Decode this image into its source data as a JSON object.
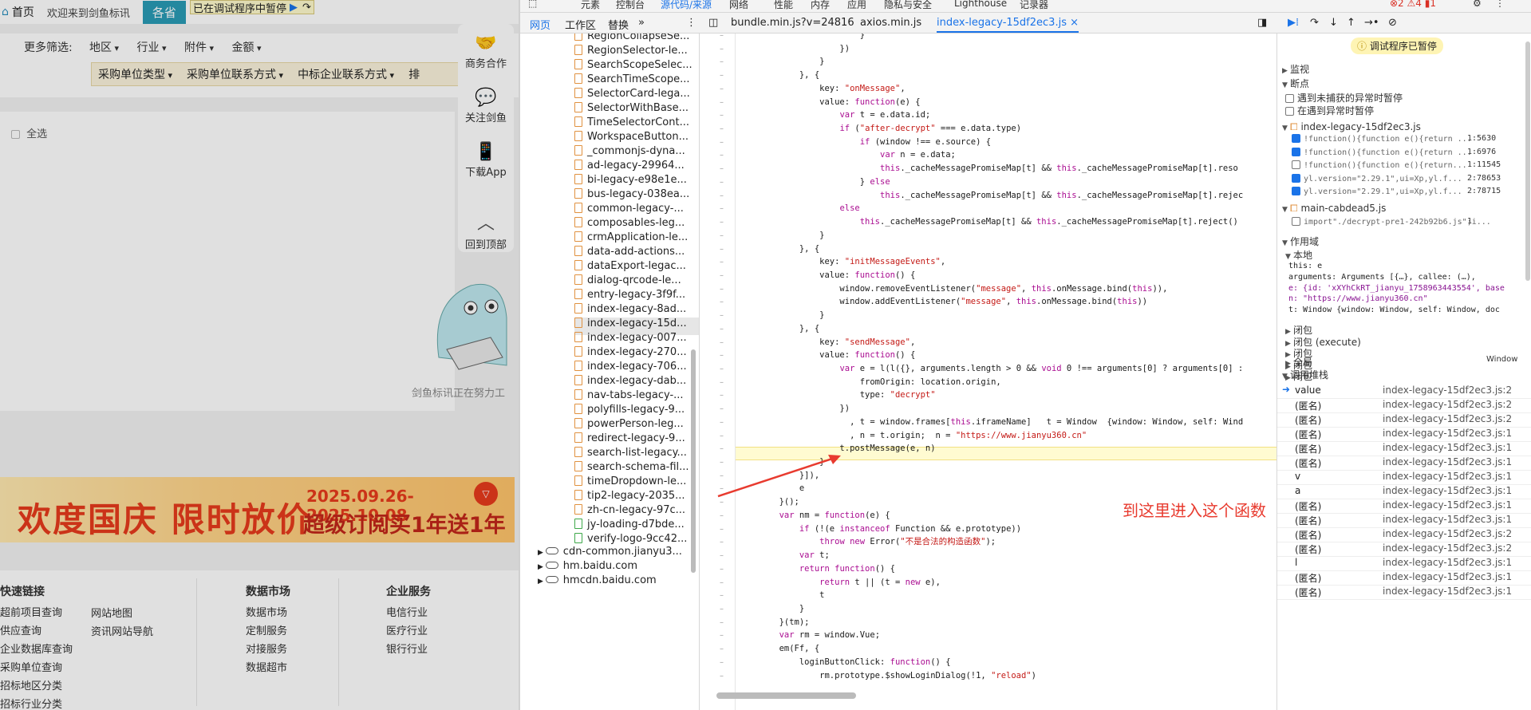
{
  "page": {
    "home": "首页",
    "welcome": "欢迎来到剑鱼标讯",
    "top_button": "各省",
    "paused_banner": "已在调试程序中暂停",
    "more_filters": "更多筛选:",
    "filters_row1": [
      "地区",
      "行业",
      "附件",
      "金额"
    ],
    "filters_row2": [
      "采购单位类型",
      "采购单位联系方式",
      "中标企业联系方式",
      "排"
    ],
    "select_all": "全选",
    "side_float": [
      "商务合作",
      "关注剑鱼",
      "下载App",
      "回到顶部"
    ],
    "mascot_caption": "剑鱼标讯正在努力工",
    "banner": {
      "main": "欢度国庆  限时放价",
      "date": "2025.09.26-2025.10.08",
      "sub": "超级订阅买1年送1年"
    },
    "footer": {
      "col1_title": "快速链接",
      "col1": [
        "超前项目查询",
        "供应查询",
        "企业数据库查询",
        "采购单位查询",
        "招标地区分类",
        "招标行业分类"
      ],
      "col1b": [
        "网站地图",
        "资讯网站导航"
      ],
      "col2_title": "数据市场",
      "col2": [
        "数据市场",
        "定制服务",
        "对接服务",
        "数据超市"
      ],
      "col3_title": "企业服务",
      "col3": [
        "电信行业",
        "医疗行业",
        "银行行业"
      ]
    }
  },
  "devtools": {
    "top_tabs": [
      "元素",
      "控制台",
      "源代码/来源",
      "网络",
      "性能",
      "内存",
      "应用",
      "隐私与安全",
      "Lighthouse",
      "记录器"
    ],
    "left_tabs": [
      "网页",
      "工作区",
      "替换"
    ],
    "file_tabs": [
      "bundle.min.js?v=24816",
      "axios.min.js",
      "index-legacy-15df2ec3.js"
    ],
    "files": [
      "RegionCollapseSe...",
      "RegionSelector-le...",
      "SearchScopeSelec...",
      "SearchTimeScope...",
      "SelectorCard-lega...",
      "SelectorWithBase...",
      "TimeSelectorCont...",
      "WorkspaceButton...",
      "_commonjs-dyna...",
      "ad-legacy-29964...",
      "bi-legacy-e98e1e...",
      "bus-legacy-038ea...",
      "common-legacy-...",
      "composables-leg...",
      "crmApplication-le...",
      "data-add-actions...",
      "dataExport-legac...",
      "dialog-qrcode-le...",
      "entry-legacy-3f9f...",
      "index-legacy-8ad...",
      "index-legacy-15d...",
      "index-legacy-007...",
      "index-legacy-270...",
      "index-legacy-706...",
      "index-legacy-dab...",
      "nav-tabs-legacy-...",
      "polyfills-legacy-9...",
      "powerPerson-leg...",
      "redirect-legacy-9...",
      "search-list-legacy...",
      "search-schema-fil...",
      "timeDropdown-le...",
      "tip2-legacy-2035...",
      "zh-cn-legacy-97c...",
      "jy-loading-d7bde...",
      "verify-logo-9cc42..."
    ],
    "domains": [
      "cdn-common.jianyu3...",
      "hm.baidu.com",
      "hmcdn.baidu.com"
    ],
    "code_lines": [
      "                        }",
      "                    })",
      "                }",
      "            }, {",
      "                key: \"onMessage\",",
      "                value: function(e) {",
      "                    var t = e.data.id;",
      "                    if (\"after-decrypt\" === e.data.type)",
      "                        if (window !== e.source) {",
      "                            var n = e.data;",
      "                            this._cacheMessagePromiseMap[t] && this._cacheMessagePromiseMap[t].reso",
      "                        } else",
      "                            this._cacheMessagePromiseMap[t] && this._cacheMessagePromiseMap[t].rejec",
      "                    else",
      "                        this._cacheMessagePromiseMap[t] && this._cacheMessagePromiseMap[t].reject()",
      "                }",
      "            }, {",
      "                key: \"initMessageEvents\",",
      "                value: function() {",
      "                    window.removeEventListener(\"message\", this.onMessage.bind(this)),",
      "                    window.addEventListener(\"message\", this.onMessage.bind(this))",
      "                }",
      "            }, {",
      "                key: \"sendMessage\",",
      "                value: function() {",
      "                    var e = l(l({}, arguments.length > 0 && void 0 !== arguments[0] ? arguments[0] :",
      "                        fromOrigin: location.origin,",
      "                        type: \"decrypt\"",
      "                    })",
      "                      , t = window.frames[this.iframeName]   t = Window  {window: Window, self: Wind",
      "                      , n = t.origin;  n = \"https://www.jianyu360.cn\"",
      "                    t.postMessage(e, n)",
      "                }",
      "            }]),",
      "            e",
      "        }();",
      "        var nm = function(e) {",
      "            if (!(e instanceof Function && e.prototype))",
      "                throw new Error(\"不是合法的构造函数\");",
      "            var t;",
      "            return function() {",
      "                return t || (t = new e),",
      "                t",
      "            }",
      "        }(tm);",
      "        var rm = window.Vue;",
      "        em(Ff, {",
      "            loginButtonClick: function() {",
      "                rm.prototype.$showLoginDialog(!1, \"reload\")"
    ],
    "annotation": "到这里进入这个函数（前提把所有断点取消掉）",
    "paused_label": "调试程序已暂停",
    "watch": "监视",
    "breakpoints_title": "断点",
    "bp_options": [
      "遇到未捕获的异常时暂停",
      "在遇到异常时暂停"
    ],
    "bp_file1": "index-legacy-15df2ec3.js",
    "bp_items": [
      {
        "code": "!function(){function e(){return ...",
        "loc": "1:5630",
        "checked": true
      },
      {
        "code": "!function(){function e(){return ...",
        "loc": "1:6976",
        "checked": true
      },
      {
        "code": "!function(){function e(){return...",
        "loc": "1:11545",
        "checked": false
      },
      {
        "code": "yl.version=\"2.29.1\",ui=Xp,yl.f...",
        "loc": "2:78653",
        "checked": true
      },
      {
        "code": "yl.version=\"2.29.1\",ui=Xp,yl.f...",
        "loc": "2:78715",
        "checked": true
      }
    ],
    "bp_file2": "main-cabdead5.js",
    "bp_item2": {
      "code": "import\"./decrypt-pre1-242b92b6.js\";i...",
      "loc": "1"
    },
    "scope_title": "作用域",
    "scope_local": "本地",
    "scope_rows": [
      "this: e",
      "arguments: Arguments [{…}, callee: (…), ",
      "e: {id: 'xXYhCkRT_jianyu_1758963443554', base",
      "n: \"https://www.jianyu360.cn\"",
      "t: Window {window: Window, self: Window, doc"
    ],
    "closures": [
      "闭包",
      "闭包 (execute)",
      "闭包",
      "闭包",
      "闭包"
    ],
    "global": "全局",
    "global_val": "Window",
    "callstack_title": "调用堆栈",
    "callstack": [
      {
        "name": "value",
        "file": "index-legacy-15df2ec3.js:2"
      },
      {
        "name": "(匿名)",
        "file": "index-legacy-15df2ec3.js:2"
      },
      {
        "name": "(匿名)",
        "file": "index-legacy-15df2ec3.js:2"
      },
      {
        "name": "(匿名)",
        "file": "index-legacy-15df2ec3.js:1"
      },
      {
        "name": "(匿名)",
        "file": "index-legacy-15df2ec3.js:1"
      },
      {
        "name": "(匿名)",
        "file": "index-legacy-15df2ec3.js:1"
      },
      {
        "name": "v",
        "file": "index-legacy-15df2ec3.js:1"
      },
      {
        "name": "a",
        "file": "index-legacy-15df2ec3.js:1"
      },
      {
        "name": "(匿名)",
        "file": "index-legacy-15df2ec3.js:1"
      },
      {
        "name": "(匿名)",
        "file": "index-legacy-15df2ec3.js:1"
      },
      {
        "name": "(匿名)",
        "file": "index-legacy-15df2ec3.js:2"
      },
      {
        "name": "(匿名)",
        "file": "index-legacy-15df2ec3.js:2"
      },
      {
        "name": "l",
        "file": "index-legacy-15df2ec3.js:1"
      },
      {
        "name": "(匿名)",
        "file": "index-legacy-15df2ec3.js:1"
      },
      {
        "name": "(匿名)",
        "file": "index-legacy-15df2ec3.js:1"
      }
    ]
  }
}
